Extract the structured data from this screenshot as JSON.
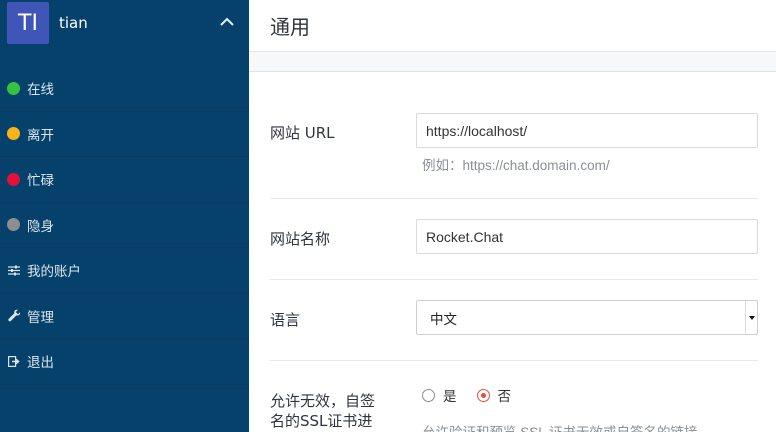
{
  "user": {
    "avatar_initials": "TI",
    "name": "tian"
  },
  "status_menu": [
    {
      "label": "在线",
      "color": "#2de0a5"
    },
    {
      "label": "离开",
      "color": "#ffd21f"
    },
    {
      "label": "忙碌",
      "color": "#f5455c"
    },
    {
      "label": "隐身",
      "color": "#9ea2a8"
    }
  ],
  "nav_menu": [
    {
      "label": "我的账户",
      "icon": "sliders-icon"
    },
    {
      "label": "管理",
      "icon": "wrench-icon"
    },
    {
      "label": "退出",
      "icon": "logout-icon"
    }
  ],
  "page": {
    "title": "通用"
  },
  "settings": {
    "site_url": {
      "label": "网站 URL",
      "value": "https://localhost/",
      "hint": "例如：https://chat.domain.com/"
    },
    "site_name": {
      "label": "网站名称",
      "value": "Rocket.Chat"
    },
    "language": {
      "label": "语言",
      "selected": "中文"
    },
    "allow_invalid_ssl": {
      "label_line1": "允许无效，自签",
      "label_line2": "名的SSL证书进",
      "option_yes": "是",
      "option_no": "否",
      "selected": "否",
      "hint": "允许验证和预览 SSL 证书无效或自签名的链接"
    }
  }
}
